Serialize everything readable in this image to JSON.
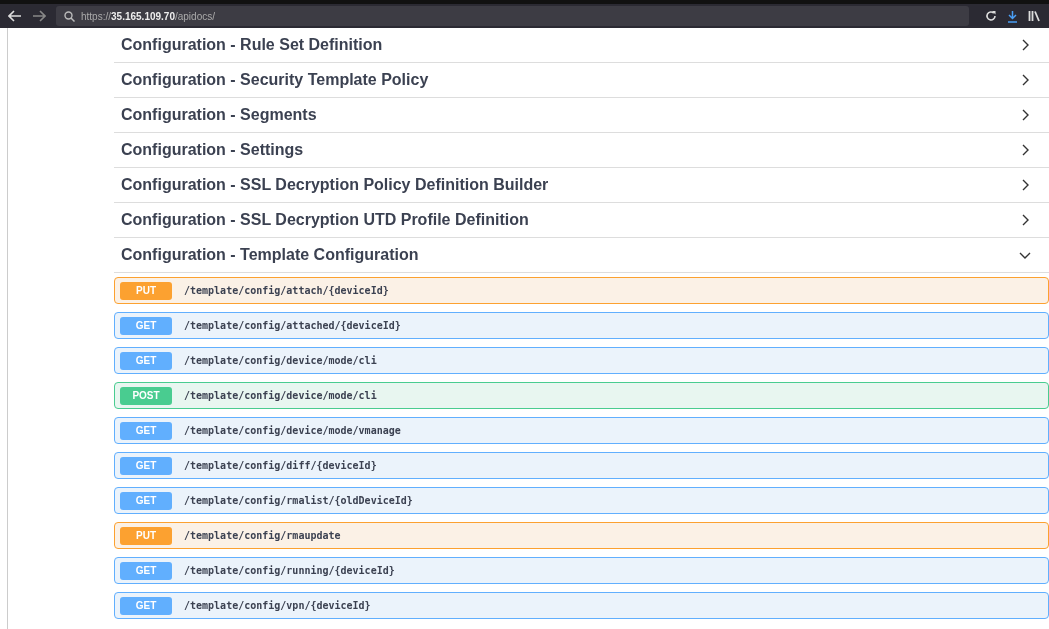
{
  "browser": {
    "url": "https://**35.165.109.70**/apidocs/"
  },
  "sections": [
    {
      "title": "Configuration - Rule Set Definition",
      "expanded": false
    },
    {
      "title": "Configuration - Security Template Policy",
      "expanded": false
    },
    {
      "title": "Configuration - Segments",
      "expanded": false
    },
    {
      "title": "Configuration - Settings",
      "expanded": false
    },
    {
      "title": "Configuration - SSL Decryption Policy Definition Builder",
      "expanded": false
    },
    {
      "title": "Configuration - SSL Decryption UTD Profile Definition",
      "expanded": false
    },
    {
      "title": "Configuration - Template Configuration",
      "expanded": true,
      "operations": [
        {
          "kind": "put",
          "method": "PUT",
          "path": "/template/config/attach/{deviceId}"
        },
        {
          "kind": "get",
          "method": "GET",
          "path": "/template/config/attached/{deviceId}"
        },
        {
          "kind": "get",
          "method": "GET",
          "path": "/template/config/device/mode/cli"
        },
        {
          "kind": "post",
          "method": "POST",
          "path": "/template/config/device/mode/cli"
        },
        {
          "kind": "get",
          "method": "GET",
          "path": "/template/config/device/mode/vmanage"
        },
        {
          "kind": "get",
          "method": "GET",
          "path": "/template/config/diff/{deviceId}"
        },
        {
          "kind": "get",
          "method": "GET",
          "path": "/template/config/rmalist/{oldDeviceId}"
        },
        {
          "kind": "put",
          "method": "PUT",
          "path": "/template/config/rmaupdate"
        },
        {
          "kind": "get",
          "method": "GET",
          "path": "/template/config/running/{deviceId}"
        },
        {
          "kind": "get",
          "method": "GET",
          "path": "/template/config/vpn/{deviceId}"
        }
      ]
    }
  ]
}
